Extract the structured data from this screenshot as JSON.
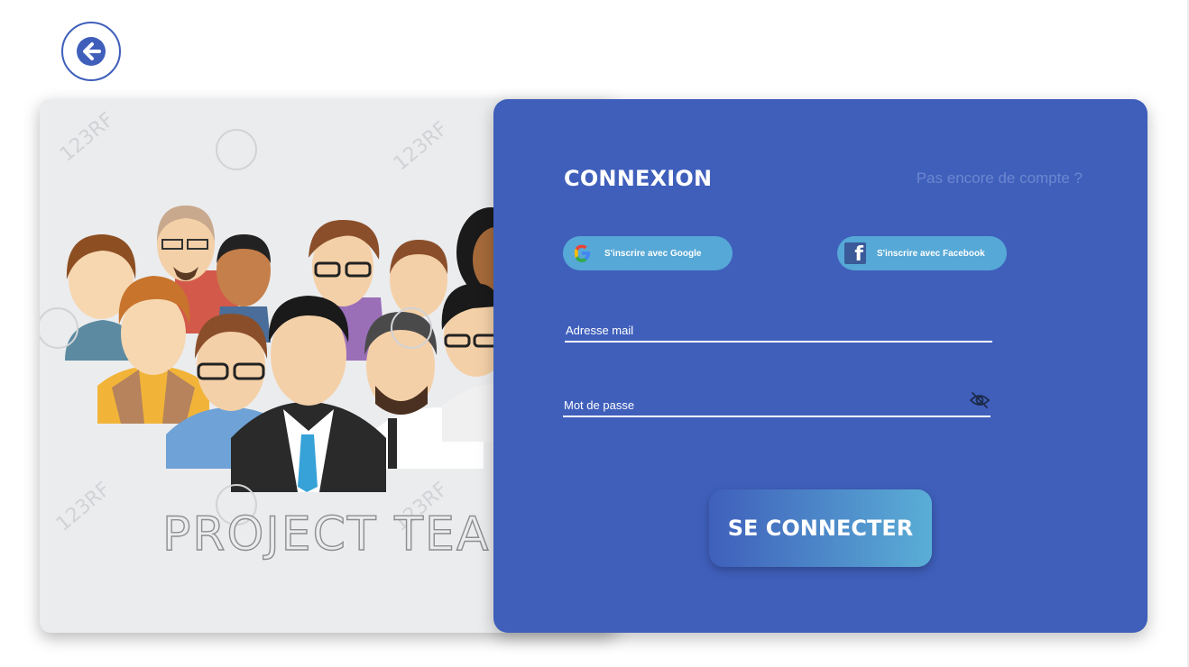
{
  "back": {
    "icon": "arrow-left-icon"
  },
  "illustration": {
    "caption": "PROJECT TEAM",
    "watermark": "123RF"
  },
  "login": {
    "title": "CONNEXION",
    "signup_link": "Pas encore de compte ?",
    "google_label": "S'inscrire avec Google",
    "facebook_label": "S'inscrire avec Facebook",
    "email_placeholder": "Adresse mail",
    "password_placeholder": "Mot de passe",
    "submit_label": "SE CONNECTER"
  },
  "colors": {
    "primary": "#3f5fbb",
    "accent": "#56a8d6",
    "link": "#6d86cf"
  }
}
